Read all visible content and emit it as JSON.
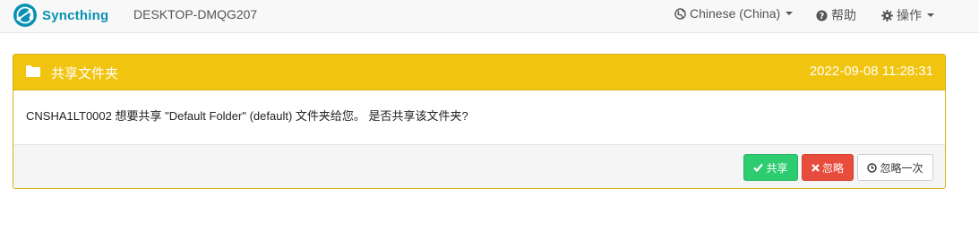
{
  "navbar": {
    "brand": "Syncthing",
    "device_name": "DESKTOP-DMQG207",
    "language": "Chinese (China)",
    "help": "帮助",
    "actions": "操作"
  },
  "notification": {
    "title": "共享文件夹",
    "timestamp": "2022-09-08 11:28:31",
    "message": "CNSHA1LT0002 想要共享 \"Default Folder\" (default) 文件夹给您。 是否共享该文件夹?",
    "buttons": {
      "share": "共享",
      "ignore": "忽略",
      "dismiss": "忽略一次"
    }
  },
  "colors": {
    "brand": "#0891b2",
    "warning": "#f1c40f",
    "success": "#2ecc71",
    "danger": "#e74c3c"
  },
  "icons": {
    "brand": "syncthing-logo-icon",
    "language": "globe-icon",
    "help": "question-circle-icon",
    "actions": "gear-icon",
    "panel": "folder-icon",
    "share": "check-icon",
    "ignore": "times-icon",
    "dismiss": "clock-icon"
  }
}
